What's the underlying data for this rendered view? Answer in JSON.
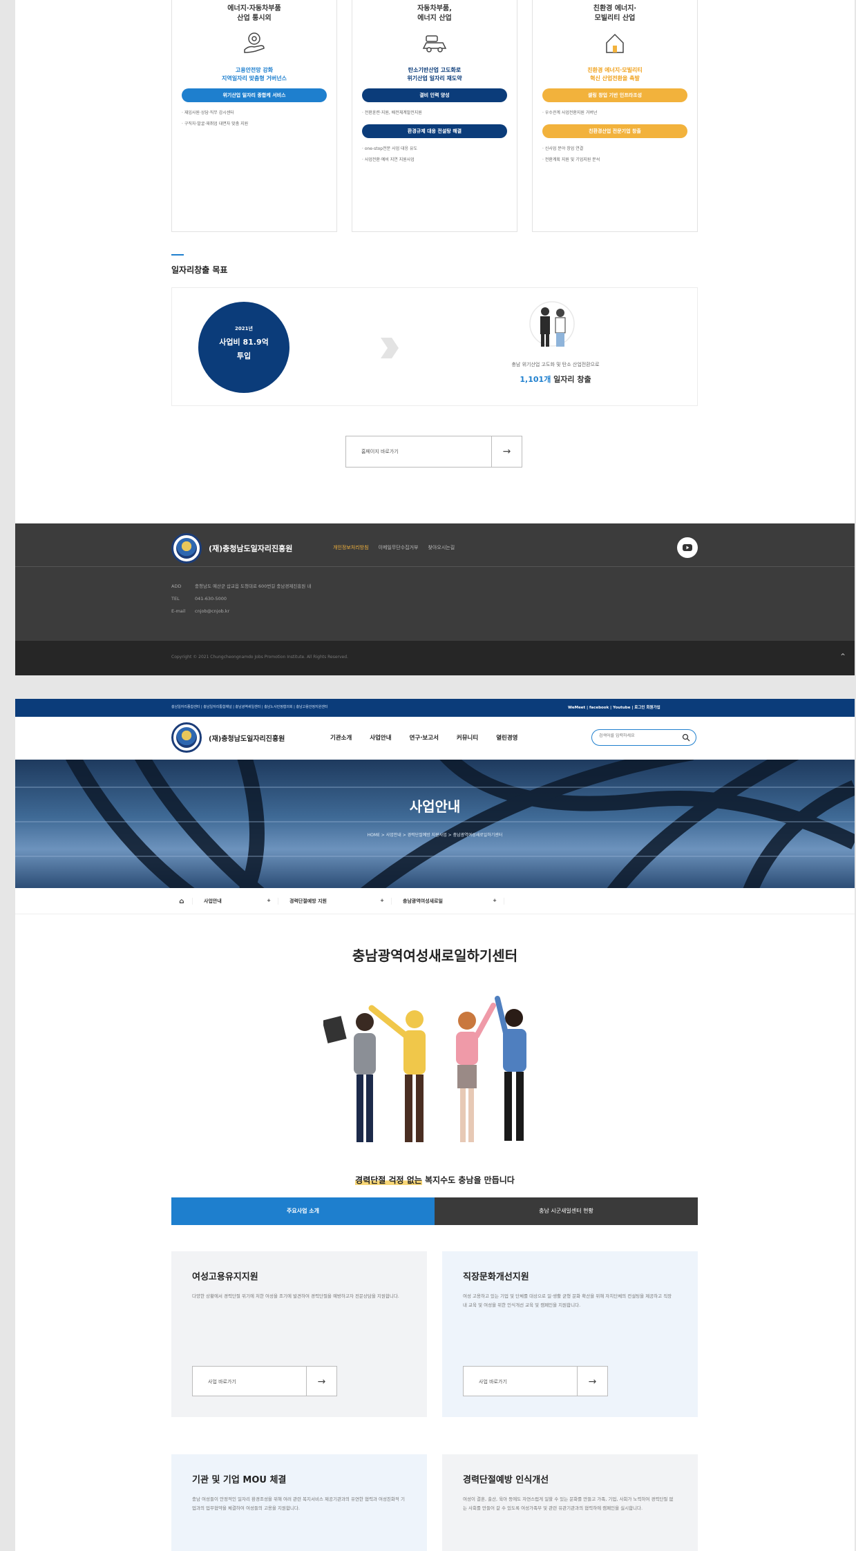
{
  "frame1": {
    "columns": [
      {
        "title_line1": "에너지·자동차부품",
        "title_line2": "산업 통시외",
        "icon": "hand-gear-icon",
        "sub_line1": "고용안전망 강화",
        "sub_line2": "지역일자리 맞춤형 거버넌스",
        "sub_color": "#1e7fce",
        "pills": [
          {
            "label": "위기산업 일자리 종합케 서비스",
            "color": "#1e7fce",
            "bullets": [
              "재입사원·상담·직무 감시센터",
              "구직자·발굴·재취업 대면자 맞춤 지원"
            ]
          }
        ]
      },
      {
        "title_line1": "자동차부품,",
        "title_line2": "에너지 산업",
        "icon": "car-icon",
        "sub_line1": "탄소기반산업 고도화로",
        "sub_line2": "위기산업 일자리 재도약",
        "sub_color": "#0b3c7a",
        "pills": [
          {
            "label": "결비 인력 양성",
            "color": "#0b3c7a",
            "bullets": [
              "전환훈련·지원, 배전체계발전지원"
            ]
          },
          {
            "label": "환경규제 대응 전설탕 해결",
            "color": "#0b3c7a",
            "bullets": [
              "one-stop전문 사업 대응 유도",
              "사업전환·예비 지연 지원사업"
            ]
          }
        ]
      },
      {
        "title_line1": "친환경 에너지·",
        "title_line2": "모빌리티 산업",
        "icon": "house-icon",
        "sub_line1": "친환경 에너지·모빌리티",
        "sub_line2": "혁신 산업전환을 촉발",
        "sub_color": "#f0a21e",
        "pills": [
          {
            "label": "셀링 창업 기반 인프라조성",
            "color": "#f2b23c",
            "bullets": [
              "우수관계 사업전환지원 거버넌",
              "대상자 상담"
            ]
          },
          {
            "label": "친환경산업 전문기업 창출",
            "color": "#f2b23c",
            "bullets": [
              "신사업 분야 창업 연결",
              "전환계획 지원 및 기업지원 분석"
            ]
          }
        ]
      }
    ],
    "goal_section_title": "일자리창출 목표",
    "goal_circle": {
      "year": "2021년",
      "line1": "사업비 81.9억",
      "line2": "투입"
    },
    "goal_text_line1": "충남 위기산업 고도화 및 탄소 산업전환으로",
    "goal_highlight": "1,101개",
    "goal_text_suffix": " 일자리 창출",
    "more_button_label": "홈페이지 바로가기",
    "footer": {
      "org_name": "(재)충청남도일자리진흥원",
      "links": [
        "개인정보처리방침",
        "이메일무단수집거부",
        "찾아오시는길"
      ],
      "addr_label": "ADD",
      "addr_value": "충청남도 예산군 삽교읍 도청대로 600번길 충남경제진흥원 내",
      "tel_label": "TEL",
      "tel_value": "041-630-5000",
      "email_label": "E-mail",
      "email_value": "cnjob@cnjob.kr",
      "copyright": "Copyright © 2021 Chungcheongnamdo Jobs Promotion Institute. All Rights Reserved."
    }
  },
  "frame2": {
    "topbar_links": "충남일자리종합센터 | 충남일자리통합채널 | 충남광역새일센터 | 충남노사민정협의회 | 충남고용안정지원센터",
    "topbar_sns": "WeMeet | facebook | Youtube | 로그인 회원가입",
    "org_name": "(재)충청남도일자리진흥원",
    "menu": [
      "기관소개",
      "사업안내",
      "연구·보고서",
      "커뮤니티",
      "열린경영"
    ],
    "search_placeholder": "검색어를 입력하세요",
    "hero_title": "사업안내",
    "hero_breadcrumb": "HOME  >  사업안내  >  경력단절예방 지원사업  >  충남광역여성새로일하기센터",
    "subnav": [
      "사업안내",
      "경력단절예방 지원",
      "충남광역여성새로일"
    ],
    "page_title": "충남광역여성새로일하기센터",
    "tagline_highlight": "경력단절 걱정 없는",
    "tagline_rest": " 복지수도 충남을 만듭니다",
    "tabs": [
      "주요사업 소개",
      "충남 시군새일센터 현황"
    ],
    "cards": [
      {
        "title": "여성고용유지지원",
        "desc": "다양한 상황에서 경력단절 위기에 처한 여성을 조기에 발견하여 경력단절을 예방하고자 전문상담을 지원합니다.",
        "btn": "사업 바로가기"
      },
      {
        "title": "직장문화개선지원",
        "desc": "여성 고용하고 있는 기업 및 단체를 대상으로 일·생활 균형 문화 확산을 위해 자치단체의 컨설팅을 제공하고 직장 내 교육 및 여성을 위한 인식개선 교육 및 캠페인을 지원합니다.",
        "btn": "사업 바로가기"
      },
      {
        "title": "기관 및 기업 MOU 체결",
        "desc": "충남 여성들이 안정적인 일자리 환경조성을 위해 여러 관련 복지서비스 제공기관과의 유연한 협력과 여성친화적 기업과의 업무협약을 체결하여 여성들의 고용을 지원합니다."
      },
      {
        "title": "경력단절예방 인식개선",
        "desc": "여성이 결혼, 출산, 육아 등에도 자연스럽게 일할 수 있는 문화를 만들고 가족, 기업, 사회가 노력하여 경력단절 없는 사회를 만들어 갈 수 있도록 여성가족부 및 관련 유관기관과의 협력하에 캠페인을 실시합니다."
      }
    ]
  }
}
